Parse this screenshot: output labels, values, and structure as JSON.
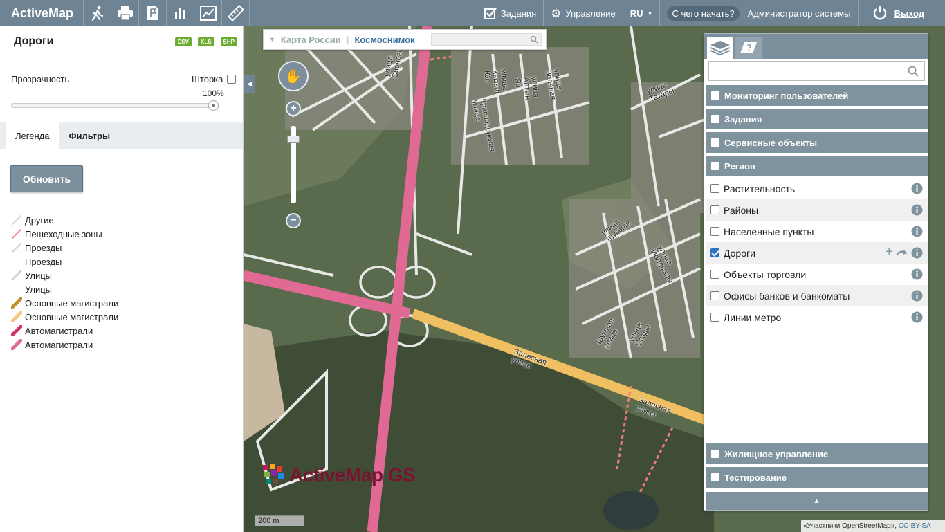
{
  "app": {
    "logo": "ActiveMap"
  },
  "topbar": {
    "icons": [
      "person-run-icon",
      "print-icon",
      "document-flag-icon",
      "bar-chart-icon",
      "line-chart-icon",
      "ruler-icon"
    ],
    "tasks": "Задания",
    "manage": "Управление",
    "lang": "RU",
    "start": "С чего начать?",
    "user": "Администратор системы",
    "logout": "Выход"
  },
  "left": {
    "title": "Дороги",
    "formats": [
      "CSV",
      "XLS",
      "SHP"
    ],
    "transparency_label": "Прозрачность",
    "curtain_label": "Шторка",
    "transparency_value": "100%",
    "transparency_fraction": 1.0,
    "tabs": [
      "Легенда",
      "Фильтры"
    ],
    "refresh": "Обновить",
    "legend": [
      {
        "label": "Другие",
        "color": "#d4d4d4",
        "style": "thin"
      },
      {
        "label": "Пешеходные зоны",
        "color": "#f08080",
        "style": "dashed"
      },
      {
        "label": "Проезды",
        "color": "#cfcfcf",
        "style": "thin"
      },
      {
        "label": "Проезды",
        "color": "",
        "style": "none"
      },
      {
        "label": "Улицы",
        "color": "#d0d0cc",
        "style": "medium"
      },
      {
        "label": "Улицы",
        "color": "",
        "style": "none"
      },
      {
        "label": "Основные магистрали",
        "color": "#c0922e",
        "style": "thick"
      },
      {
        "label": "Основные магистрали",
        "color": "#f5c77f",
        "style": "thick"
      },
      {
        "label": "Автомагистрали",
        "color": "#d1336b",
        "style": "thick"
      },
      {
        "label": "Автомагистрали",
        "color": "#dd6f8e",
        "style": "thick"
      }
    ]
  },
  "map": {
    "types": [
      "Карта России",
      "Космоснимок"
    ],
    "scale": "200 m",
    "attribution": "«Участники OpenStreetMap», ",
    "attribution_link": "CC-BY-SA",
    "watermark": "ActiveMap GS",
    "street_labels": [
      "Залесная улица",
      "Залесная улица",
      "улица Шумная",
      "Шумная улица",
      "улица Сазды",
      "улица Татары",
      "улица Йолдызлы",
      "улица Кызыл Юл",
      "улица Алтын Яр",
      "улица Сионовская",
      "Краснодонская улица",
      "улица Зелёная"
    ]
  },
  "layers": {
    "groups_top": [
      "Мониторинг пользователей",
      "Задания",
      "Сервисные объекты",
      "Регион"
    ],
    "items": [
      {
        "label": "Растительность",
        "checked": false
      },
      {
        "label": "Районы",
        "checked": false
      },
      {
        "label": "Населенные пункты",
        "checked": false
      },
      {
        "label": "Дороги",
        "checked": true
      },
      {
        "label": "Объекты торговли",
        "checked": false
      },
      {
        "label": "Офисы банков и банкоматы",
        "checked": false
      },
      {
        "label": "Линии метро",
        "checked": false
      }
    ],
    "groups_bottom": [
      "Жилищное управление",
      "Тестирование"
    ],
    "collapse_glyph": "▲"
  }
}
